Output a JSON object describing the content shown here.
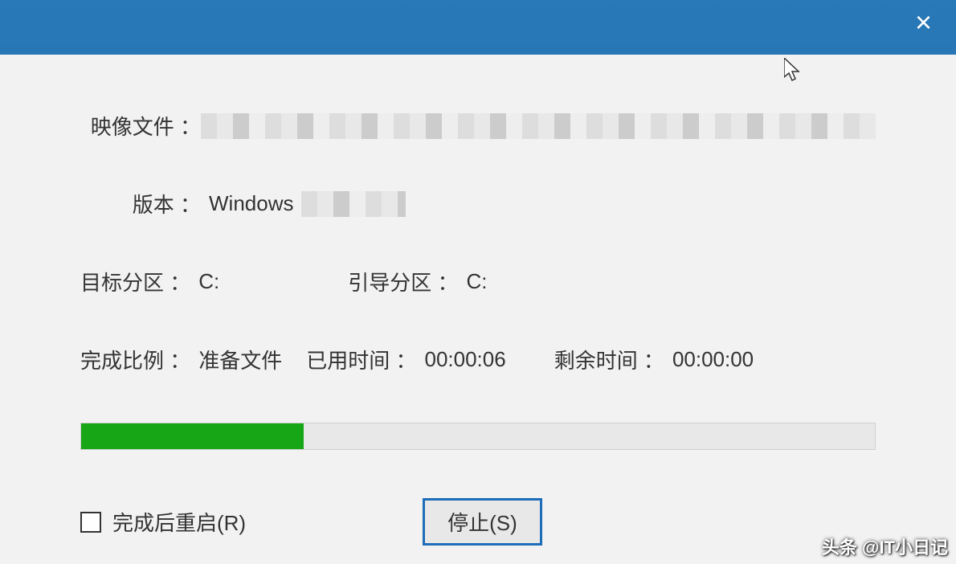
{
  "titlebar": {
    "close": "×"
  },
  "fields": {
    "image_file_label": "映像文件 ：",
    "version_label": "版本 ：",
    "version_value": "Windows",
    "target_partition_label": "目标分区 ：",
    "target_partition_value": "C:",
    "boot_partition_label": "引导分区 ：",
    "boot_partition_value": "C:",
    "progress_label": "完成比例 ：",
    "progress_status": "准备文件",
    "elapsed_label": "已用时间 ：",
    "elapsed_value": "00:00:06",
    "remaining_label": "剩余时间 ：",
    "remaining_value": "00:00:00"
  },
  "controls": {
    "restart_checkbox_label": "完成后重启(R)",
    "stop_button": "停止(S)"
  },
  "watermark": "头条 @IT小日记"
}
